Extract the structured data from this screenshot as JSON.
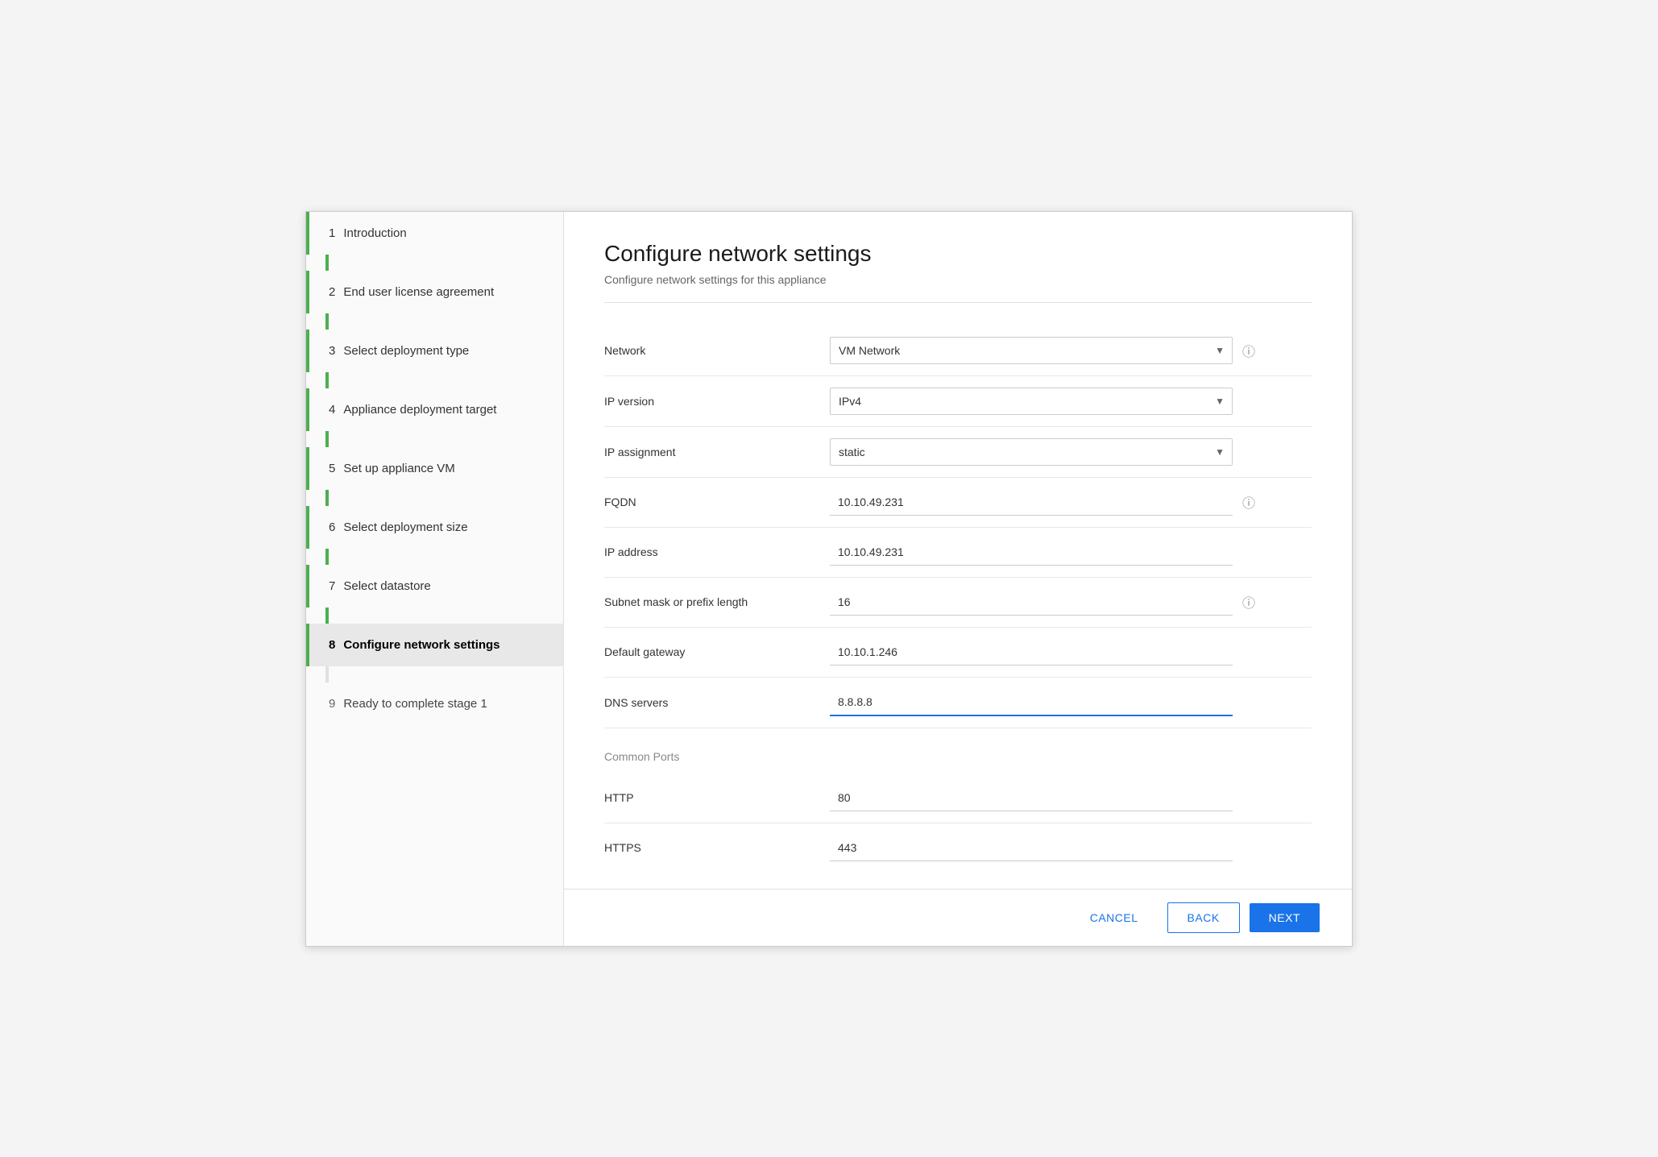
{
  "sidebar": {
    "items": [
      {
        "num": "1",
        "label": "Introduction",
        "state": "completed"
      },
      {
        "num": "2",
        "label": "End user license agreement",
        "state": "completed"
      },
      {
        "num": "3",
        "label": "Select deployment type",
        "state": "completed"
      },
      {
        "num": "4",
        "label": "Appliance deployment target",
        "state": "completed"
      },
      {
        "num": "5",
        "label": "Set up appliance VM",
        "state": "completed"
      },
      {
        "num": "6",
        "label": "Select deployment size",
        "state": "completed"
      },
      {
        "num": "7",
        "label": "Select datastore",
        "state": "completed"
      },
      {
        "num": "8",
        "label": "Configure network settings",
        "state": "active"
      },
      {
        "num": "9",
        "label": "Ready to complete stage 1",
        "state": "inactive"
      }
    ]
  },
  "main": {
    "title": "Configure network settings",
    "subtitle": "Configure network settings for this appliance",
    "form": {
      "network_label": "Network",
      "network_value": "VM Network",
      "ip_version_label": "IP version",
      "ip_version_value": "IPv4",
      "ip_assignment_label": "IP assignment",
      "ip_assignment_value": "static",
      "fqdn_label": "FQDN",
      "fqdn_value": "10.10.49.231",
      "ip_address_label": "IP address",
      "ip_address_value": "10.10.49.231",
      "subnet_label": "Subnet mask or prefix length",
      "subnet_value": "16",
      "gateway_label": "Default gateway",
      "gateway_value": "10.10.1.246",
      "dns_label": "DNS servers",
      "dns_value": "8.8.8.8",
      "common_ports_label": "Common Ports",
      "http_label": "HTTP",
      "http_value": "80",
      "https_label": "HTTPS",
      "https_value": "443"
    }
  },
  "footer": {
    "cancel_label": "CANCEL",
    "back_label": "BACK",
    "next_label": "NEXT"
  }
}
